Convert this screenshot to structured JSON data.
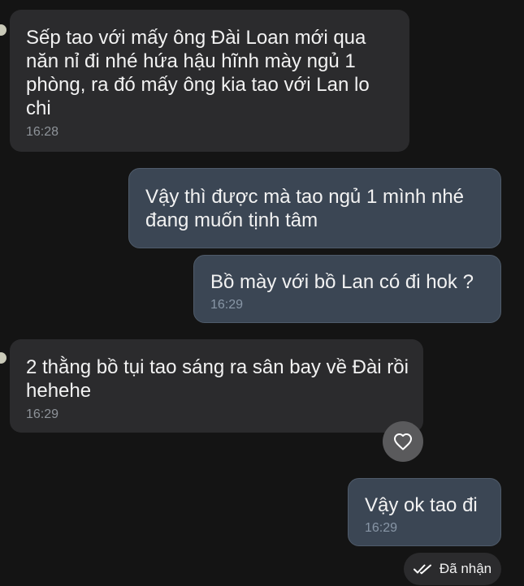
{
  "messages": [
    {
      "direction": "incoming",
      "text": "Sếp tao với mấy ông Đài Loan mới qua năn nỉ đi nhé hứa hậu hĩnh mày ngủ 1 phòng, ra đó mấy ông kia tao với Lan lo chi",
      "time": "16:28"
    },
    {
      "direction": "outgoing",
      "text": "Vậy thì được mà tao ngủ 1 mình nhé đang muốn tịnh tâm",
      "time": ""
    },
    {
      "direction": "outgoing",
      "text": "Bồ mày với bồ Lan có đi hok ?",
      "time": "16:29"
    },
    {
      "direction": "incoming",
      "text": "2 thằng bồ tụi tao sáng ra sân bay về Đài rồi hehehe",
      "time": "16:29"
    },
    {
      "direction": "outgoing",
      "text": "Vậy ok tao đi",
      "time": "16:29"
    }
  ],
  "reaction": {
    "icon": "heart-outline-icon"
  },
  "status": {
    "icon": "double-check-icon",
    "label": "Đã nhận"
  },
  "colors": {
    "background": "#141414",
    "incoming_bubble": "#2b2b2d",
    "outgoing_bubble": "#3b4654",
    "timestamp": "#8e9399"
  }
}
